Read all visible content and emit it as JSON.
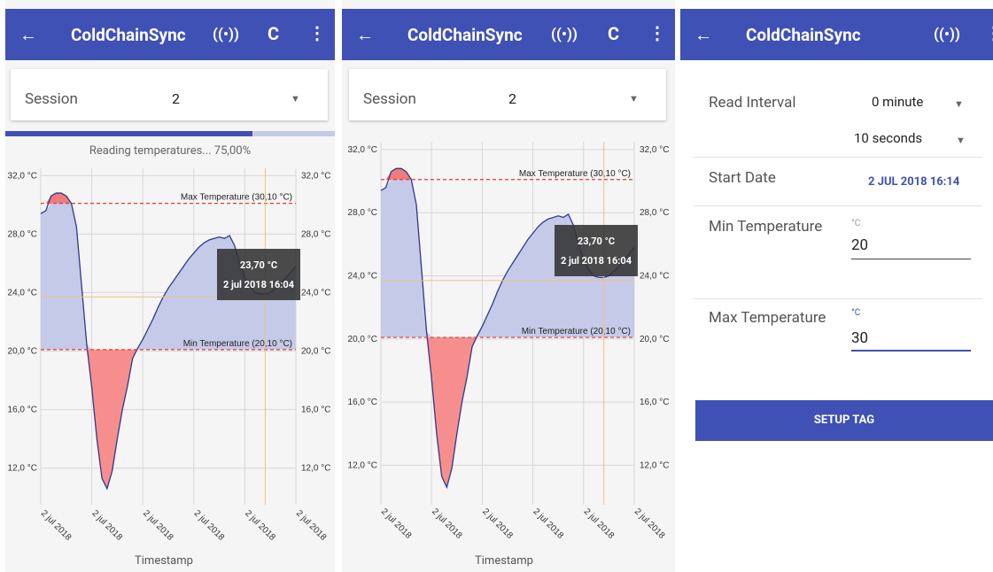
{
  "app": {
    "title": "ColdChainSync",
    "back_icon": "←",
    "nfc_icon": "((•))",
    "refresh_icon": "C",
    "more_icon": "⋮"
  },
  "session": {
    "label": "Session",
    "value": "2"
  },
  "progress": {
    "text": "Reading temperatures... 75,00%",
    "fraction": 0.75
  },
  "tooltip": {
    "temperature": "23,70 °C",
    "datetime": "2 jul 2018 16:04"
  },
  "settings": {
    "read_interval_label": "Read Interval",
    "read_interval_minutes": "0 minute",
    "read_interval_seconds": "10 seconds",
    "start_date_label": "Start Date",
    "start_date_value": "2 JUL 2018 16:14",
    "min_temp_label": "Min Temperature",
    "min_temp_unit": "°C",
    "min_temp_value": "20",
    "max_temp_label": "Max Temperature",
    "max_temp_unit": "°C",
    "max_temp_value": "30",
    "setup_button": "SETUP TAG"
  },
  "colors": {
    "primary": "#3f51b5",
    "fill_normal": "#c5cae9",
    "fill_low": "#f78e8e",
    "fill_high": "#ef7b7b",
    "line": "#2c3a8c",
    "threshold": "#e53935"
  },
  "chart_data": {
    "type": "area",
    "xlabel": "Timestamp",
    "ylabel": "",
    "ylim": [
      9.5,
      32.5
    ],
    "y_ticks": [
      "32,0 °C",
      "28,0 °C",
      "24,0 °C",
      "20,0 °C",
      "16,0 °C",
      "12,0 °C"
    ],
    "y_tick_values": [
      32,
      28,
      24,
      20,
      16,
      12
    ],
    "x_ticks": [
      "2 jul 2018",
      "2 jul 2018",
      "2 jul 2018",
      "2 jul 2018",
      "2 jul 2018",
      "2 jul 2018"
    ],
    "max_threshold": {
      "label": "Max Temperature (30,10 °C)",
      "value": 30.1
    },
    "min_threshold": {
      "label": "Min Temperature (20,10 °C)",
      "value": 20.1
    },
    "series": [
      {
        "x": [
          0,
          0.02,
          0.04,
          0.06,
          0.08,
          0.1,
          0.12,
          0.14,
          0.16,
          0.18,
          0.2,
          0.22,
          0.24,
          0.26,
          0.28,
          0.3,
          0.32,
          0.34,
          0.36,
          0.38,
          0.4,
          0.42,
          0.44,
          0.46,
          0.48,
          0.5,
          0.52,
          0.54,
          0.56,
          0.58,
          0.6,
          0.62,
          0.64,
          0.66,
          0.68,
          0.7,
          0.72,
          0.74,
          0.76,
          0.78,
          0.8,
          0.82,
          0.84,
          0.86,
          0.88,
          0.9,
          0.92,
          0.94,
          0.96,
          0.98,
          1.0
        ],
        "y": [
          29.4,
          29.6,
          30.6,
          30.8,
          30.8,
          30.6,
          30.1,
          28.5,
          24.5,
          20.5,
          17.5,
          14.0,
          11.3,
          10.6,
          11.8,
          14.0,
          16.0,
          17.6,
          19.5,
          20.2,
          20.8,
          21.5,
          22.2,
          23.0,
          23.7,
          24.3,
          24.8,
          25.3,
          25.8,
          26.3,
          26.7,
          27.1,
          27.4,
          27.6,
          27.7,
          27.8,
          27.7,
          27.9,
          27.2,
          26.0,
          25.0,
          24.4,
          24.0,
          23.9,
          23.9,
          24.0,
          24.3,
          24.6,
          25.0,
          25.4,
          25.8
        ]
      }
    ]
  }
}
